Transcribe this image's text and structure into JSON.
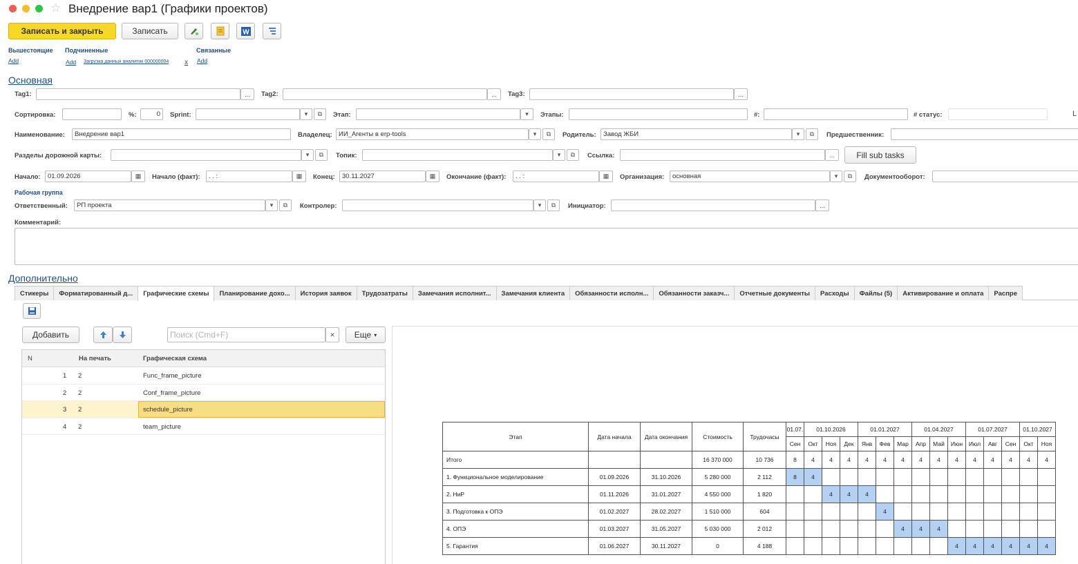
{
  "window": {
    "title": "Внедрение вар1 (Графики проектов)"
  },
  "toolbar": {
    "save_close": "Записать и закрыть",
    "save": "Записать"
  },
  "links": {
    "parents": {
      "label": "Вышестоящие",
      "add": "Add"
    },
    "children": {
      "label": "Подчиненные",
      "add": "Add",
      "item": "Загрузка данных аналитик 000000004",
      "remove": "x"
    },
    "related": {
      "label": "Связанные",
      "add": "Add"
    }
  },
  "main_section": "Основная",
  "fields": {
    "tag1": "Tag1:",
    "tag2": "Tag2:",
    "tag3": "Tag3:",
    "sort_label": "Сортировка:",
    "percent_label": "%:",
    "percent_value": "0",
    "sprint_label": "Sprint:",
    "stage_label": "Этап:",
    "stages_label": "Этапы:",
    "num_label": "#:",
    "status_label": "# статус:",
    "cut_label": "L",
    "name_label": "Наименование:",
    "name_value": "Внедрение вар1",
    "owner_label": "Владелец:",
    "owner_value": "ИИ_Агенты в erp-tools",
    "parent_label": "Родитель:",
    "parent_value": "Завод ЖБИ",
    "predecessor_label": "Предшественник:",
    "roadmap_label": "Разделы дорожной карты:",
    "topic_label": "Топик:",
    "link_label": "Ссылка:",
    "fill_subtasks": "Fill sub tasks",
    "start_label": "Начало:",
    "start_value": "01.09.2026",
    "start_fact_label": "Начало (факт):",
    "start_fact_value": " .  .    :",
    "end_label": "Конец:",
    "end_value": "30.11.2027",
    "end_fact_label": "Окончание (факт):",
    "end_fact_value": " .  .    :",
    "org_label": "Организация:",
    "org_value": "основная",
    "docflow_label": "Документооборот:",
    "workgroup": "Рабочая группа",
    "resp_label": "Ответственный:",
    "resp_value": "РП проекта",
    "controller_label": "Контролер:",
    "initiator_label": "Инициатор:",
    "comment_label": "Комментарий:"
  },
  "extra_section": "Дополнительно",
  "tabs": [
    "Стикеры",
    "Форматированный д...",
    "Графические схемы",
    "Планирование дохо...",
    "История заявок",
    "Трудозатраты",
    "Замечания исполнит...",
    "Замечания клиента",
    "Обязанности исполн...",
    "Обязанности заказч...",
    "Отчетные документы",
    "Расходы",
    "Файлы (5)",
    "Активирование и оплата",
    "Распре"
  ],
  "list": {
    "add": "Добавить",
    "search_placeholder": "Поиск (Cmd+F)",
    "clear": "×",
    "more": "Еще",
    "columns": {
      "n": "N",
      "print": "На печать",
      "scheme": "Графическая схема"
    },
    "rows": [
      {
        "n": "1",
        "print": "2",
        "scheme": "Func_frame_picture"
      },
      {
        "n": "2",
        "print": "2",
        "scheme": "Conf_frame_picture"
      },
      {
        "n": "3",
        "print": "2",
        "scheme": "schedule_picture"
      },
      {
        "n": "4",
        "print": "2",
        "scheme": "team_picture"
      }
    ]
  },
  "schedule": {
    "headers": {
      "stage": "Этап",
      "start": "Дата начала",
      "end": "Дата окончания",
      "cost": "Стоимость",
      "labor": "Трудочасы"
    },
    "quarters": [
      "01.07.",
      "01.10.2026",
      "01.01.2027",
      "01.04.2027",
      "01.07.2027",
      "01.10.2027"
    ],
    "months": [
      "Сен",
      "Окт",
      "Ноя",
      "Дек",
      "Янв",
      "Фев",
      "Мар",
      "Апр",
      "Май",
      "Июн",
      "Июл",
      "Авг",
      "Сен",
      "Окт",
      "Ноя"
    ],
    "total": {
      "stage": "Итого",
      "cost": "16 370 000",
      "labor": "10 736",
      "months": [
        "8",
        "4",
        "4",
        "4",
        "4",
        "4",
        "4",
        "4",
        "4",
        "4",
        "4",
        "4",
        "4",
        "4",
        "4"
      ]
    },
    "rows": [
      {
        "stage": "1. Функциональное моделирование",
        "start": "01.09.2026",
        "end": "31.10.2026",
        "cost": "5 280 000",
        "labor": "2 112",
        "cells": [
          "8",
          "4",
          "",
          "",
          "",
          "",
          "",
          "",
          "",
          "",
          "",
          "",
          "",
          "",
          ""
        ]
      },
      {
        "stage": "2. НиР",
        "start": "01.11.2026",
        "end": "31.01.2027",
        "cost": "4 550 000",
        "labor": "1 820",
        "cells": [
          "",
          "",
          "4",
          "4",
          "4",
          "",
          "",
          "",
          "",
          "",
          "",
          "",
          "",
          "",
          ""
        ]
      },
      {
        "stage": "3. Подготовка к ОПЭ",
        "start": "01.02.2027",
        "end": "28.02.2027",
        "cost": "1 510 000",
        "labor": "604",
        "cells": [
          "",
          "",
          "",
          "",
          "",
          "4",
          "",
          "",
          "",
          "",
          "",
          "",
          "",
          "",
          ""
        ]
      },
      {
        "stage": "4. ОПЭ",
        "start": "01.03.2027",
        "end": "31.05.2027",
        "cost": "5 030 000",
        "labor": "2 012",
        "cells": [
          "",
          "",
          "",
          "",
          "",
          "",
          "4",
          "4",
          "4",
          "",
          "",
          "",
          "",
          "",
          ""
        ]
      },
      {
        "stage": "5. Гарантия",
        "start": "01.06.2027",
        "end": "30.11.2027",
        "cost": "0",
        "labor": "4 188",
        "cells": [
          "",
          "",
          "",
          "",
          "",
          "",
          "",
          "",
          "",
          "4",
          "4",
          "4",
          "4",
          "4",
          "4"
        ]
      }
    ]
  }
}
